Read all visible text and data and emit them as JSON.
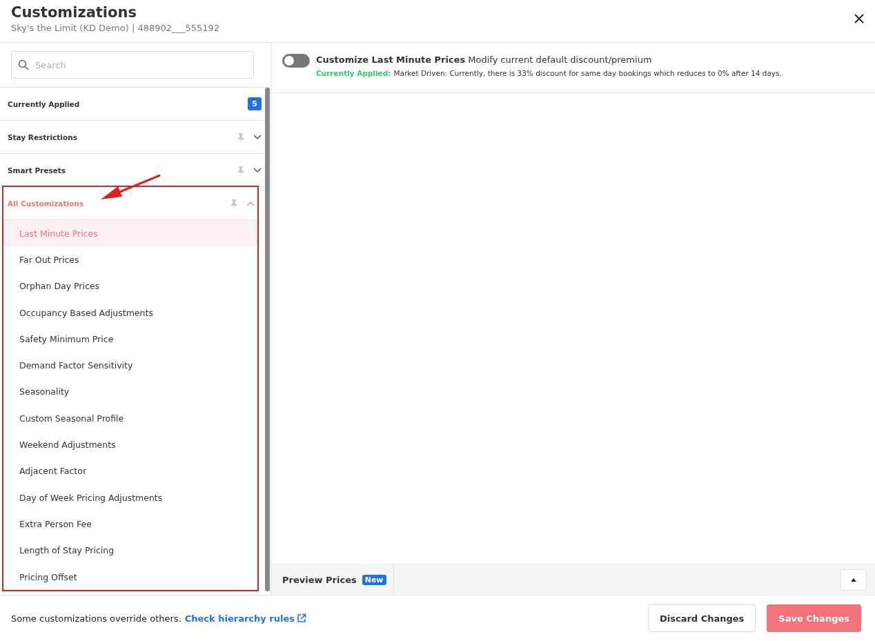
{
  "header": {
    "title": "Customizations",
    "subtitle": "Sky's the Limit (KD Demo) | 488902___555192"
  },
  "sidebar": {
    "search": {
      "placeholder": "Search"
    },
    "sections": [
      {
        "kind": "count",
        "label": "Currently Applied",
        "count": "5",
        "active": false
      },
      {
        "kind": "collapsible",
        "label": "Stay Restrictions",
        "expanded": false,
        "active": false
      },
      {
        "kind": "collapsible",
        "label": "Smart Presets",
        "expanded": false,
        "active": false
      },
      {
        "kind": "collapsible",
        "label": "All Customizations",
        "expanded": true,
        "active": true,
        "items": [
          {
            "label": "Last Minute Prices",
            "selected": true
          },
          {
            "label": "Far Out Prices",
            "selected": false
          },
          {
            "label": "Orphan Day Prices",
            "selected": false
          },
          {
            "label": "Occupancy Based Adjustments",
            "selected": false
          },
          {
            "label": "Safety Minimum Price",
            "selected": false
          },
          {
            "label": "Demand Factor Sensitivity",
            "selected": false
          },
          {
            "label": "Seasonality",
            "selected": false
          },
          {
            "label": "Custom Seasonal Profile",
            "selected": false
          },
          {
            "label": "Weekend Adjustments",
            "selected": false
          },
          {
            "label": "Adjacent Factor",
            "selected": false
          },
          {
            "label": "Day of Week Pricing Adjustments",
            "selected": false
          },
          {
            "label": "Extra Person Fee",
            "selected": false
          },
          {
            "label": "Length of Stay Pricing",
            "selected": false
          },
          {
            "label": "Pricing Offset",
            "selected": false
          }
        ]
      }
    ]
  },
  "detail": {
    "toggle": {
      "on": false
    },
    "title": "Customize Last Minute Prices",
    "description": "Modify current default discount/premium",
    "applied_label": "Currently Applied:",
    "applied_text": "Market Driven: Currently, there is 33% discount for same day bookings which reduces to 0% after 14 days."
  },
  "preview": {
    "label": "Preview Prices",
    "badge": "New"
  },
  "footer": {
    "note": "Some customizations override others.",
    "link": "Check hierarchy rules",
    "buttons": [
      {
        "kind": "secondary",
        "label": "Discard Changes"
      },
      {
        "kind": "primary",
        "label": "Save Changes"
      }
    ]
  }
}
